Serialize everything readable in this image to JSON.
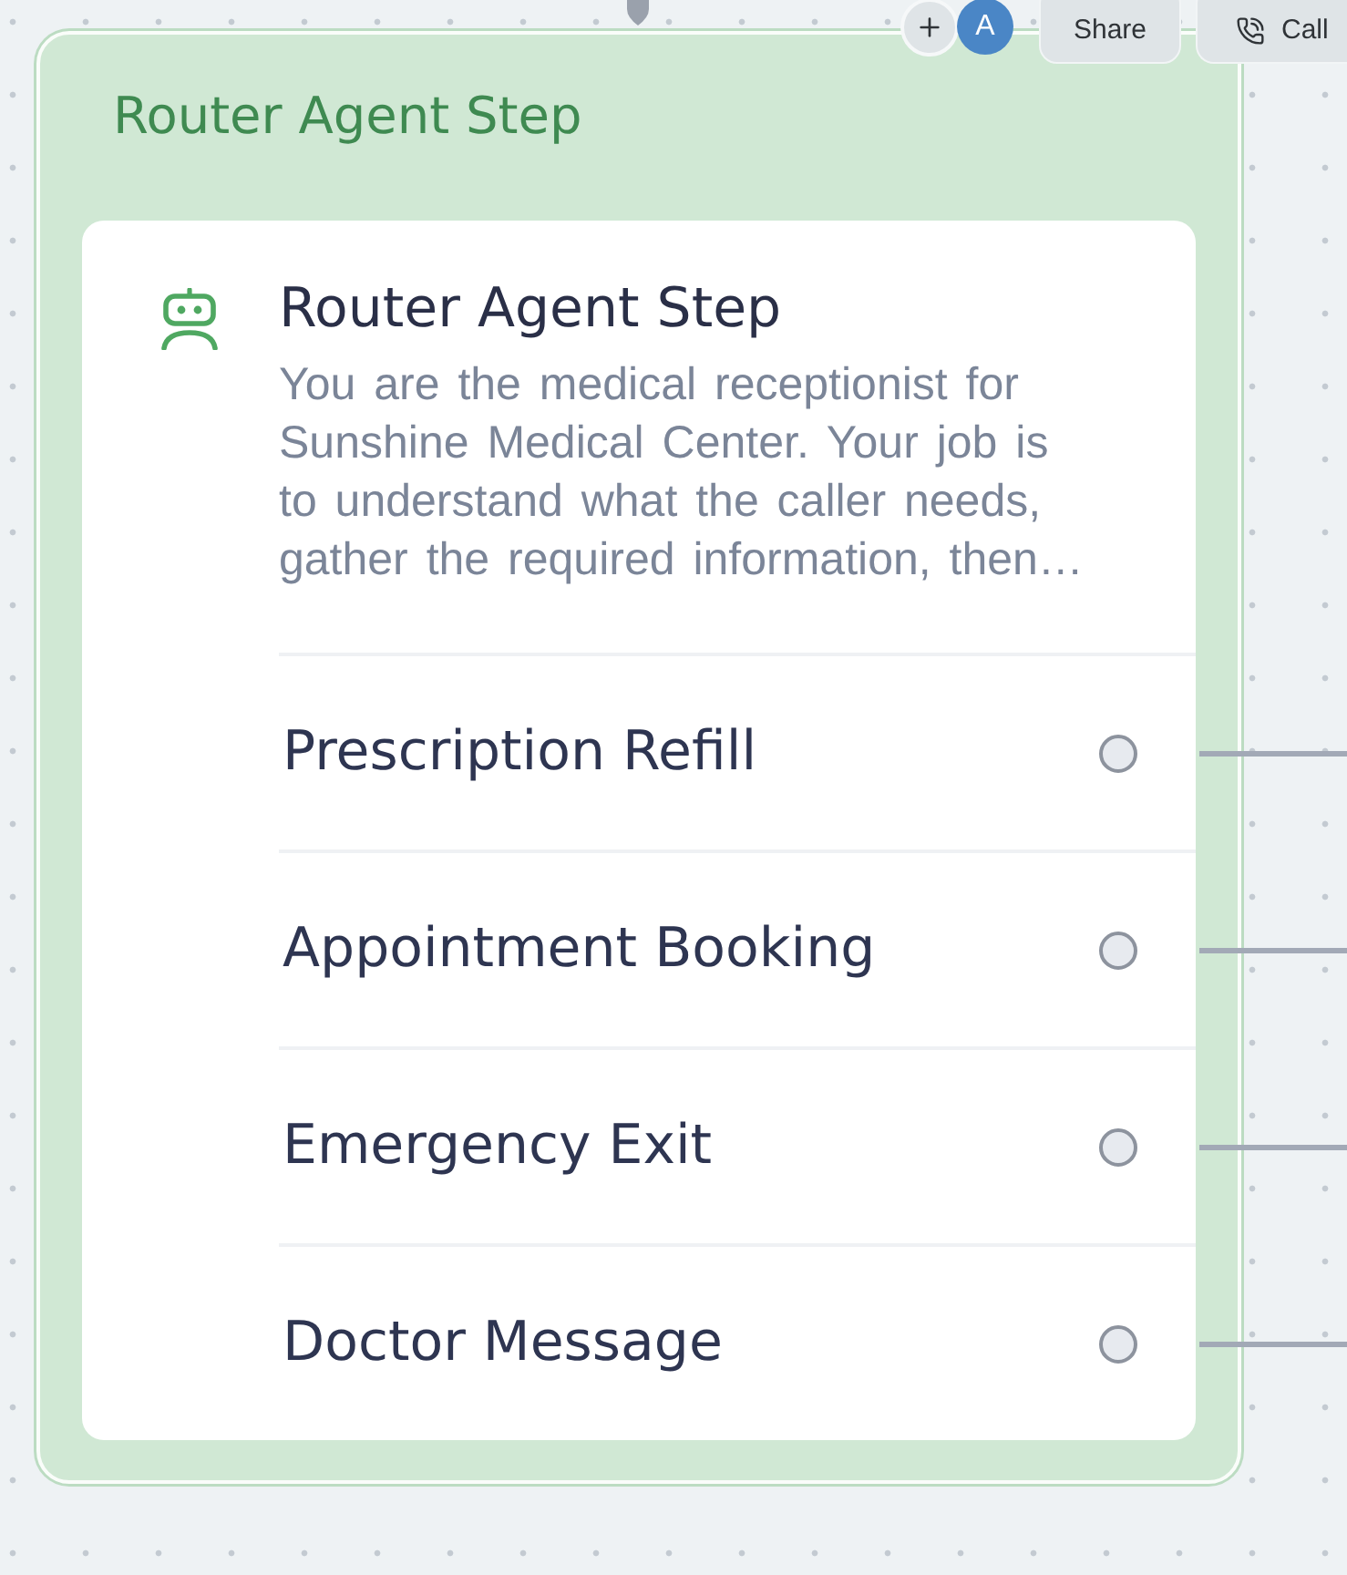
{
  "toolbar": {
    "avatar": "A",
    "buttons": [
      {
        "kind": "share",
        "label": "Share"
      },
      {
        "kind": "call",
        "label": "Call"
      }
    ]
  },
  "node": {
    "title": "Router Agent Step",
    "card": {
      "title": "Router Agent Step",
      "description": "You are the medical receptionist for Sunshine Medical Center. Your job is to understand what the caller needs, gather the required information, then…",
      "routes": [
        {
          "label": "Prescription Refill",
          "connected": true
        },
        {
          "label": "Appointment Booking",
          "connected": true
        },
        {
          "label": "Emergency Exit",
          "connected": true
        },
        {
          "label": "Doctor Message",
          "connected": true
        }
      ]
    }
  }
}
